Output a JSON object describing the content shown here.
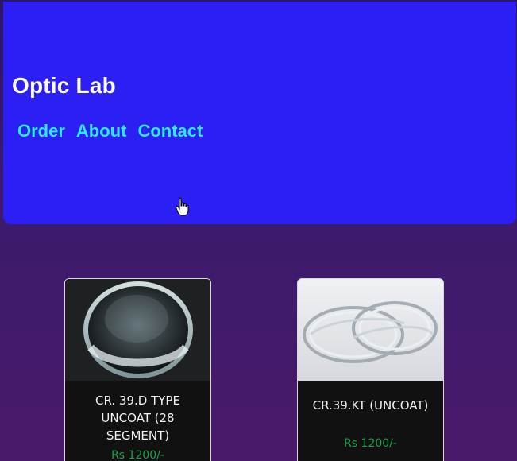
{
  "header": {
    "brand": "Optic Lab",
    "nav": [
      "Order",
      "About",
      "Contact"
    ],
    "color": "#2b1ff3",
    "nav_color": "#2ee9f2"
  },
  "products": [
    {
      "title": "CR. 39.D TYPE UNCOAT (28 SEGMENT)",
      "price": "Rs 1200/-"
    },
    {
      "title": "CR.39.KT (UNCOAT)",
      "price": "Rs 1200/-"
    }
  ],
  "icons": {
    "cursor": "hand-pointer-icon"
  }
}
